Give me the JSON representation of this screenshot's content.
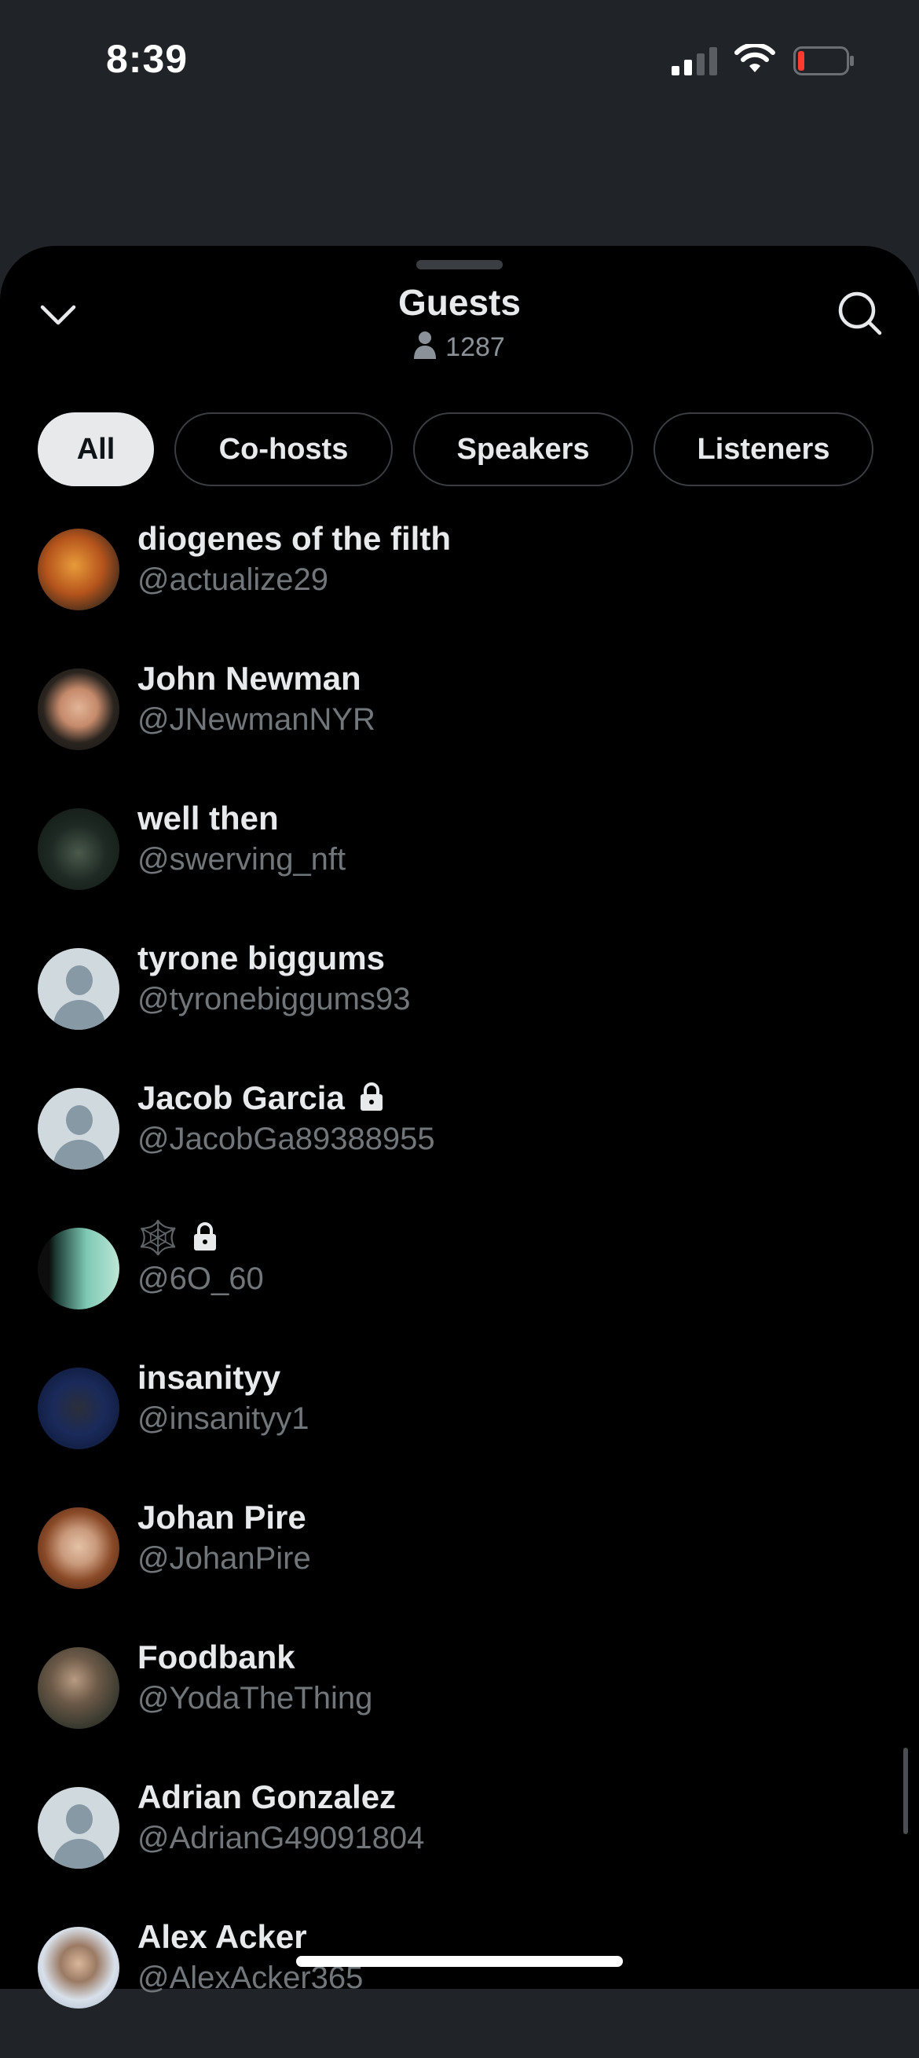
{
  "status_bar": {
    "time": "8:39"
  },
  "sheet": {
    "title": "Guests",
    "listener_count": "1287",
    "tabs": [
      {
        "label": "All",
        "active": true
      },
      {
        "label": "Co-hosts",
        "active": false
      },
      {
        "label": "Speakers",
        "active": false
      },
      {
        "label": "Listeners",
        "active": false
      }
    ]
  },
  "guests": [
    {
      "name": "diogenes of the filth",
      "handle": "@actualize29",
      "avatar": "photo",
      "locked": false
    },
    {
      "name": "John Newman",
      "handle": "@JNewmanNYR",
      "avatar": "photo",
      "locked": false
    },
    {
      "name": "well then",
      "handle": "@swerving_nft",
      "avatar": "photo",
      "locked": false
    },
    {
      "name": "tyrone biggums",
      "handle": "@tyronebiggums93",
      "avatar": "default",
      "locked": false
    },
    {
      "name": "Jacob Garcia",
      "handle": "@JacobGa89388955",
      "avatar": "default",
      "locked": true
    },
    {
      "name": "🕸️",
      "handle": "@6O_60",
      "avatar": "photo",
      "locked": true
    },
    {
      "name": "insanityy",
      "handle": "@insanityy1",
      "avatar": "photo",
      "locked": false
    },
    {
      "name": "Johan Pire",
      "handle": "@JohanPire",
      "avatar": "photo",
      "locked": false
    },
    {
      "name": "Foodbank",
      "handle": "@YodaTheThing",
      "avatar": "photo",
      "locked": false
    },
    {
      "name": "Adrian Gonzalez",
      "handle": "@AdrianG49091804",
      "avatar": "default",
      "locked": false
    },
    {
      "name": "Alex Acker",
      "handle": "@AlexAcker365",
      "avatar": "photo",
      "locked": false
    }
  ],
  "colors": {
    "background": "#000000",
    "dimmed_background": "#202327",
    "primary_text": "#e7e9ea",
    "secondary_text": "#71767b",
    "battery_low": "#ff3b30"
  }
}
